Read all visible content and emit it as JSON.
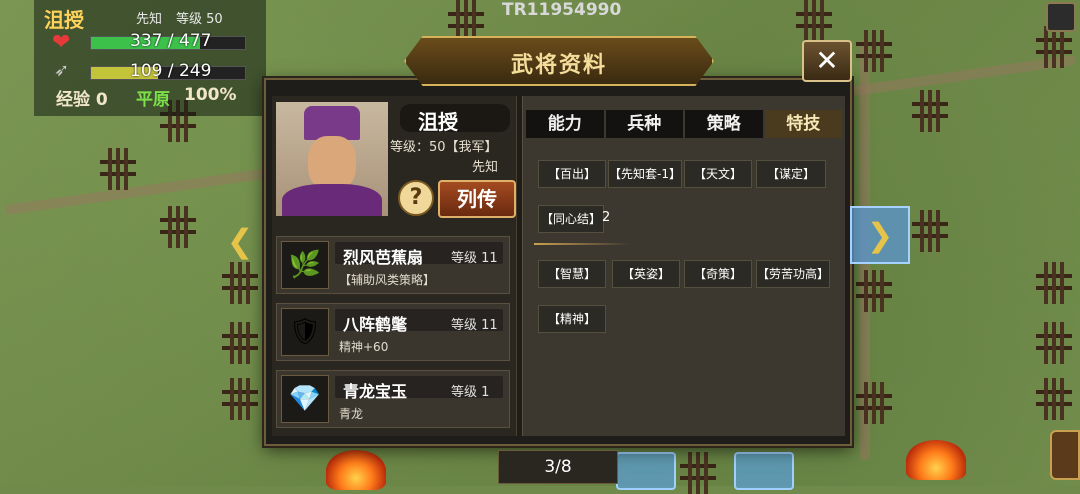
{
  "map_code": "TR11954990",
  "status": {
    "name": "沮授",
    "class": "先知",
    "level_label": "等级",
    "level": "50",
    "hp_text": "337 / 477",
    "hp_fraction": 0.706,
    "mp_text": "109 / 249",
    "mp_fraction": 0.438,
    "exp_label": "经验",
    "exp_value": "0",
    "terrain": "平原",
    "terrain_pct": "100%"
  },
  "dialog": {
    "title": "武将资料",
    "close_label": "✕",
    "general": {
      "name": "沮授",
      "level_line": "等级：50【我军】",
      "class": "先知",
      "help_label": "?",
      "bio_label": "列传"
    },
    "equipment": [
      {
        "name": "烈风芭蕉扇",
        "level": "等级 11",
        "desc": "【辅助风类策略】",
        "icon": "fan-leaf-icon",
        "glyph": "🌿"
      },
      {
        "name": "八阵鹤氅",
        "level": "等级 11",
        "desc": "精神+60",
        "icon": "armor-icon",
        "glyph": "🛡"
      },
      {
        "name": "青龙宝玉",
        "level": "等级 1",
        "desc": "青龙",
        "icon": "jewel-icon",
        "glyph": "💎"
      }
    ],
    "tabs": [
      "能力",
      "兵种",
      "策略",
      "特技"
    ],
    "active_tab": 3,
    "skills_row1": [
      "【百出】",
      "【先知套-1】",
      "【天文】",
      "【谋定】"
    ],
    "skills_row2": [
      "【同心结】"
    ],
    "skills_row2_extra": "2",
    "skills_row3": [
      "【智慧】",
      "【英姿】",
      "【奇策】",
      "【劳苦功高】"
    ],
    "skills_row4": [
      "【精神】"
    ]
  },
  "pagination": "3/8",
  "colors": {
    "title_gold": "#f4dc9a",
    "hp_green": "#3cc24a",
    "mp_yellow": "#c4c43a",
    "terrain_green": "#7ce04a"
  }
}
